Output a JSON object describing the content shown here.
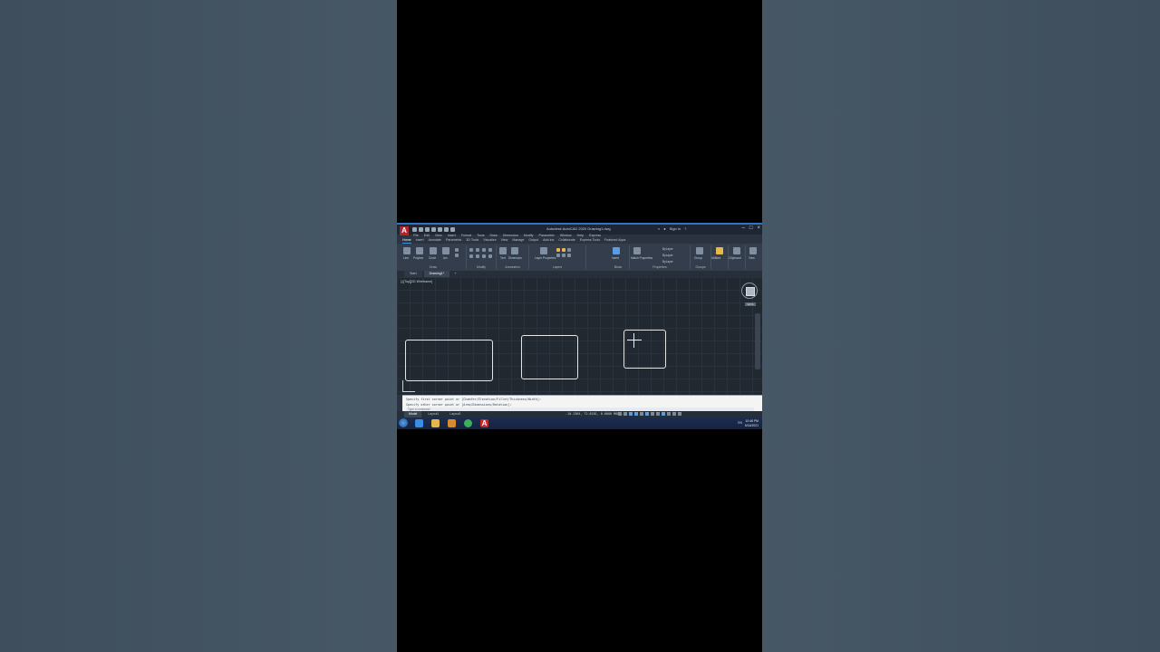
{
  "window": {
    "title": "Autodesk AutoCAD 2020  Drawing1.dwg",
    "search_label": "Sign In",
    "logo": "A"
  },
  "menus": [
    "File",
    "Edit",
    "View",
    "Insert",
    "Format",
    "Tools",
    "Draw",
    "Dimension",
    "Modify",
    "Parametric",
    "Window",
    "Help",
    "Express"
  ],
  "ribbon_tabs": [
    "Home",
    "Insert",
    "Annotate",
    "Parametric",
    "3D Tools",
    "Visualize",
    "View",
    "Manage",
    "Output",
    "Add-ins",
    "Collaborate",
    "Express Tools",
    "Featured Apps"
  ],
  "ribbon": {
    "draw": {
      "label": "Draw",
      "tools": [
        "Line",
        "Polyline",
        "Circle",
        "Arc"
      ]
    },
    "modify": {
      "label": "Modify"
    },
    "annotation": {
      "label": "Annotation",
      "tools": [
        "Text",
        "Dimension"
      ]
    },
    "layers": {
      "label": "Layers",
      "tools": [
        "Layer Properties"
      ]
    },
    "block": {
      "label": "Block",
      "tools": [
        "Insert"
      ]
    },
    "properties": {
      "label": "Properties",
      "tools": [
        "Match Properties"
      ],
      "values": [
        "ByLayer",
        "ByLayer",
        "ByLayer"
      ]
    },
    "groups": {
      "label": "Groups",
      "tools": [
        "Group"
      ]
    },
    "utilities": {
      "tools": [
        "Utilities"
      ]
    },
    "clipboard": {
      "tools": [
        "Clipboard"
      ]
    },
    "view": {
      "tools": [
        "View"
      ]
    }
  },
  "doc_tabs": [
    "Start",
    "Drawing1*"
  ],
  "viewport": {
    "label": "[-][Top][2D Wireframe]"
  },
  "view_cube": {
    "wcs_label": "WCS"
  },
  "command_line": {
    "history": [
      "Specify first corner point or [Chamfer/Elevation/Fillet/Thickness/Width]:",
      "Specify other corner point or [Area/Dimensions/Rotation]:"
    ],
    "placeholder": "Type a command"
  },
  "layout_tabs": [
    "Model",
    "Layout1",
    "Layout2"
  ],
  "status_bar": {
    "coordinates": "-10.1364, 72.8181, 0.0000",
    "mode": "MODEL"
  },
  "taskbar": {
    "tray_lang": "EN",
    "time": "10:46 PM",
    "date": "6/16/2021"
  }
}
